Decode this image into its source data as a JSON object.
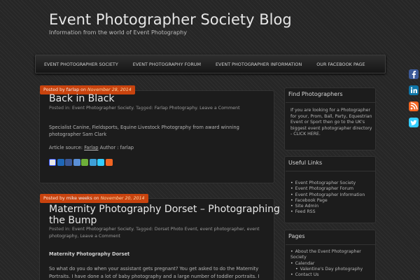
{
  "site": {
    "title": "Event Photographer Society Blog",
    "description": "Information from the world of Event Photography"
  },
  "nav": {
    "items": [
      "EVENT PHOTOGRAPHER SOCIETY",
      "EVENT PHOTOGRAPHY FORUM",
      "EVENT PHOTOGRAPHER INFORMATION",
      "OUR FACEBOOK PAGE"
    ]
  },
  "social": [
    "facebook-icon",
    "linkedin-icon",
    "rss-icon",
    "twitter-icon"
  ],
  "colors": {
    "accent": "#c8430e",
    "background": "#2b2b2b",
    "panel": "#1c1c1c"
  },
  "posts": [
    {
      "posted_by": "Posted by",
      "author": "farlap",
      "on": "on",
      "date": "November 28, 2014",
      "title": "Back in Black",
      "posted_in": "Posted in:",
      "category": "Event Photographer Society",
      "tagged": ". Tagged:",
      "tag": "Farlap Photography",
      "comment_link": "Leave a Comment",
      "body": "Specialist Canine, Fieldsports, Equine Livestock Photography from award winning photographer Sam Clark",
      "source_label": "Article source:",
      "source_link": "Farlap",
      "source_author": "Author : farlap"
    },
    {
      "posted_by": "Posted by",
      "author": "mike weeks",
      "on": "on",
      "date": "November 20, 2014",
      "title_line1": "Maternity Photography Dorset – Photographing",
      "title_line2": "the Bump",
      "posted_in": "Posted in:",
      "category": "Event Photographer Society",
      "tagged": ". Tagged:",
      "tags": "Dorset Photo Event, event photographer, event",
      "tags_cont": "photography",
      "comment_link": "Leave a Comment",
      "subheading": "Maternity Photography Dorset",
      "body_line1": "So what do you do when your assistant gets pregnant? You get asked to do the Maternity",
      "body_line2": "Portraits. I have done a lot of baby photography and a large number of toddler portraits. I"
    }
  ],
  "sidebar": {
    "find": {
      "title": "Find Photographers",
      "text": "If you are looking for a Photographer for your, Prom, Ball, Party, Equestrian Event or Sport then go to the UK's biggest event photographer directory - CLICK HERE."
    },
    "useful": {
      "title": "Useful Links",
      "items": [
        "Event Photographer Society",
        "Event Photographer Forum",
        "Event Photographer Information",
        "Facebook Page",
        "Site Admin",
        "Feed RSS"
      ]
    },
    "pages": {
      "title": "Pages",
      "items": [
        "About the Event Photographer Society",
        "Calendar",
        "Valentine's Day photography",
        "Contact Us"
      ]
    }
  }
}
